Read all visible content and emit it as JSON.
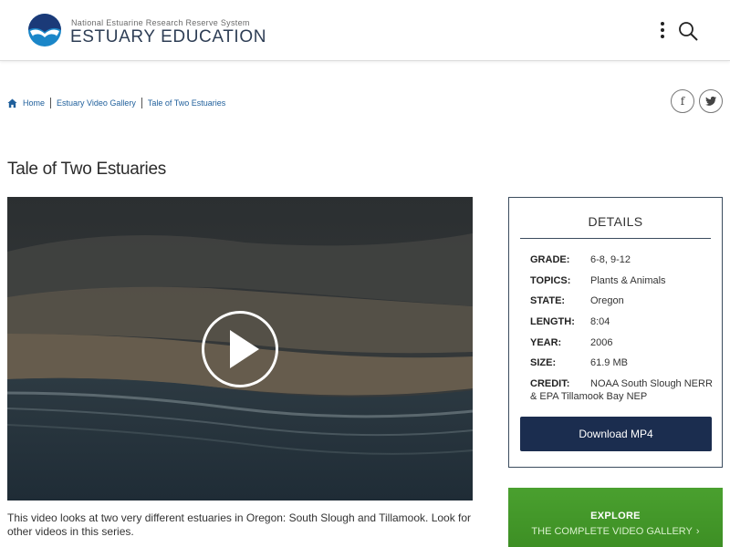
{
  "header": {
    "org_name": "National Estuarine Research Reserve System",
    "site_name": "ESTUARY EDUCATION",
    "menu_icon": "kebab-menu-icon",
    "search_icon": "search-icon"
  },
  "breadcrumb": {
    "home": "Home",
    "gallery": "Estuary Video Gallery",
    "current": "Tale of Two Estuaries"
  },
  "share": {
    "facebook": "f",
    "twitter_icon": "twitter-icon"
  },
  "page": {
    "title": "Tale of Two Estuaries",
    "description": "This video looks at two very different estuaries in Oregon: South Slough and Tillamook. Look for other videos in this series."
  },
  "details": {
    "heading": "DETAILS",
    "rows": [
      {
        "label": "GRADE:",
        "value": "6-8, 9-12"
      },
      {
        "label": "TOPICS:",
        "value": "Plants & Animals"
      },
      {
        "label": "STATE:",
        "value": "Oregon"
      },
      {
        "label": "LENGTH:",
        "value": "8:04"
      },
      {
        "label": "YEAR:",
        "value": "2006"
      },
      {
        "label": "SIZE:",
        "value": "61.9 MB"
      }
    ],
    "credit": {
      "label": "CREDIT:",
      "line1": "NOAA South Slough NERR",
      "line2": "& EPA Tillamook Bay NEP"
    },
    "download_label": "Download MP4"
  },
  "explore": {
    "title": "EXPLORE",
    "subtitle": "THE COMPLETE VIDEO GALLERY",
    "chevron": "›"
  },
  "colors": {
    "brand_navy": "#2e3e55",
    "download_bg": "#1b2d4f",
    "explore_green": "#46992b",
    "link_blue": "#1f5f9b"
  }
}
